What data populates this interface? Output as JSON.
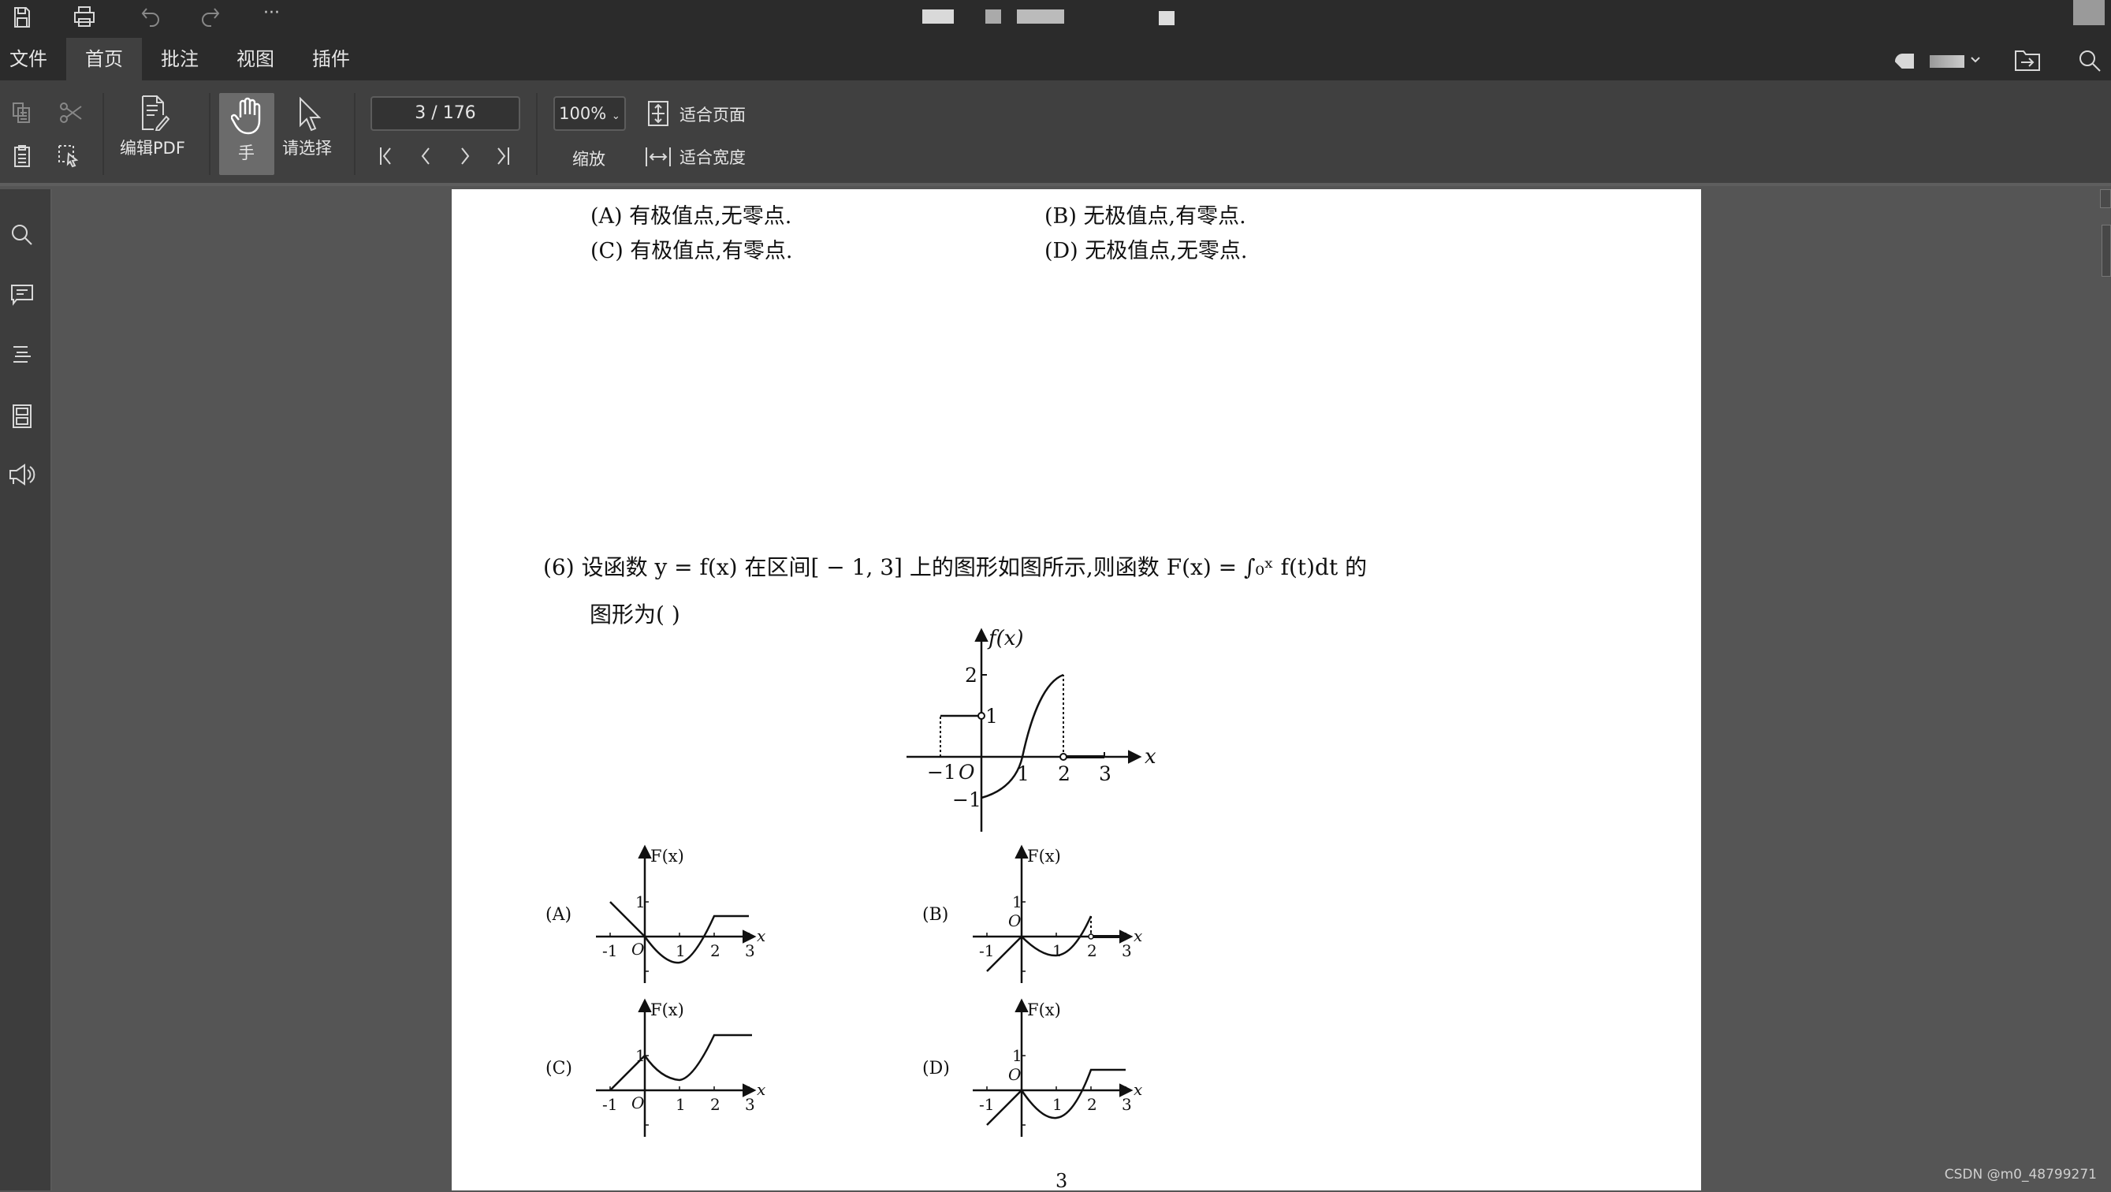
{
  "titlebar": {
    "icons": [
      "save-icon",
      "print-icon",
      "undo-icon",
      "redo-icon",
      "more-icon"
    ],
    "more_label": "···"
  },
  "menu": {
    "items": [
      {
        "label": "文件"
      },
      {
        "label": "首页",
        "active": true
      },
      {
        "label": "批注"
      },
      {
        "label": "视图"
      },
      {
        "label": "插件"
      }
    ]
  },
  "toolbar": {
    "edit_pdf": "编辑PDF",
    "hand": "手",
    "select": "请选择",
    "page_indicator": "3 / 176",
    "zoom_value": "100%",
    "zoom_label": "缩放",
    "fit_page": "适合页面",
    "fit_width": "适合宽度"
  },
  "sidebar": {
    "icons": [
      "search-icon",
      "comment-icon",
      "outline-icon",
      "thumbnails-icon",
      "read-aloud-icon"
    ]
  },
  "document": {
    "options_prev": {
      "a": "(A) 有极值点,无零点.",
      "b": "(B) 无极值点,有零点.",
      "c": "(C) 有极值点,有零点.",
      "d": "(D) 无极值点,无零点."
    },
    "question_line1": "(6) 设函数 y = f(x) 在区间[ − 1, 3] 上的图形如图所示,则函数 F(x) = ∫₀ˣ f(t)dt 的",
    "question_line2": "图形为(      )",
    "main_graph": {
      "ylabel": "f(x)",
      "xlabel": "x",
      "origin": "O",
      "xticks": [
        "−1",
        "1",
        "2",
        "3"
      ],
      "yticks": [
        "2",
        "1",
        "−1"
      ]
    },
    "choices": [
      {
        "label": "(A)",
        "ylabel": "F(x)",
        "xlabel": "x",
        "origin": "O",
        "xticks": [
          "-1",
          "1",
          "2",
          "3"
        ],
        "ytick": "1"
      },
      {
        "label": "(B)",
        "ylabel": "F(x)",
        "xlabel": "x",
        "origin": "O",
        "xticks": [
          "-1",
          "1",
          "2",
          "3"
        ],
        "ytick": "1"
      },
      {
        "label": "(C)",
        "ylabel": "F(x)",
        "xlabel": "x",
        "origin": "O",
        "xticks": [
          "-1",
          "1",
          "2",
          "3"
        ],
        "ytick": "1"
      },
      {
        "label": "(D)",
        "ylabel": "F(x)",
        "xlabel": "x",
        "origin": "O",
        "xticks": [
          "-1",
          "1",
          "2",
          "3"
        ],
        "ytick": "1"
      }
    ],
    "page_number": "3"
  },
  "watermark": "CSDN @m0_48799271",
  "colors": {
    "titlebar": "#2b2b2b",
    "toolbar": "#404040",
    "canvas": "#555555",
    "active_tool": "#6b6b6b"
  }
}
